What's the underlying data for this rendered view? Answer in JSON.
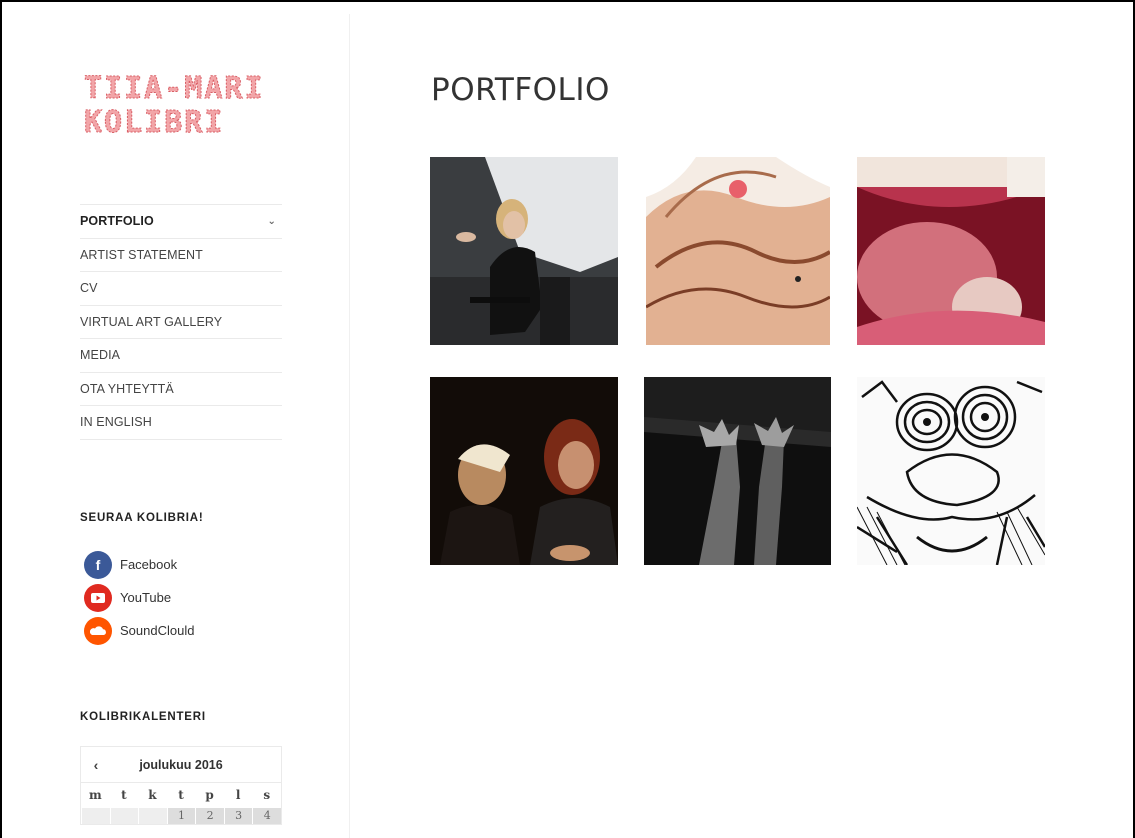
{
  "site": {
    "logo_text_line1": "TIIA-MARI",
    "logo_text_line2": "KOLIBRI"
  },
  "nav": {
    "items": [
      {
        "label": "PORTFOLIO",
        "active": true,
        "has_submenu": true
      },
      {
        "label": "ARTIST STATEMENT"
      },
      {
        "label": "CV"
      },
      {
        "label": "VIRTUAL ART GALLERY"
      },
      {
        "label": "MEDIA"
      },
      {
        "label": "OTA YHTEYTTÄ"
      },
      {
        "label": "IN ENGLISH"
      }
    ]
  },
  "follow": {
    "title": "SEURAA KOLIBRIA!",
    "links": [
      {
        "label": "Facebook",
        "icon": "facebook-icon",
        "color": "#3b5998"
      },
      {
        "label": "YouTube",
        "icon": "youtube-icon",
        "color": "#e02a20"
      },
      {
        "label": "SoundClould",
        "icon": "soundcloud-icon",
        "color": "#ff5500"
      }
    ]
  },
  "calendar": {
    "title": "KOLIBRIKALENTERI",
    "month": "joulukuu 2016",
    "prev_symbol": "‹",
    "weekdays": [
      "m",
      "t",
      "k",
      "t",
      "p",
      "l",
      "s"
    ],
    "first_row": [
      "",
      "",
      "",
      "1",
      "2",
      "3",
      "4"
    ]
  },
  "main": {
    "page_title": "PORTFOLIO",
    "thumbnails": [
      {
        "name": "thumb-lecture-photo"
      },
      {
        "name": "thumb-watercolor-body"
      },
      {
        "name": "thumb-open-mouth"
      },
      {
        "name": "thumb-two-performers"
      },
      {
        "name": "thumb-hands-dark"
      },
      {
        "name": "thumb-ink-drawing-face"
      }
    ]
  },
  "colors": {
    "logo_pink": "#f2a5a8",
    "logo_red": "#d95f66",
    "text": "#333333",
    "divider": "#eaeaea"
  }
}
